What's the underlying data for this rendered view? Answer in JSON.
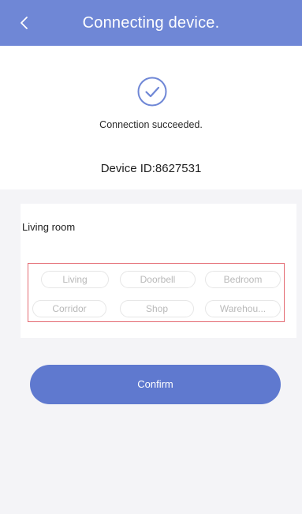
{
  "header": {
    "title": "Connecting device."
  },
  "status": {
    "message": "Connection succeeded.",
    "device_id": "Device ID:8627531"
  },
  "name_field": {
    "value": "Living room"
  },
  "tags": [
    {
      "label": "Living"
    },
    {
      "label": "Doorbell"
    },
    {
      "label": "Bedroom"
    },
    {
      "label": "Corridor"
    },
    {
      "label": "Shop"
    },
    {
      "label": "Warehou..."
    }
  ],
  "actions": {
    "confirm_label": "Confirm"
  },
  "colors": {
    "header": "#6f87d6",
    "primary_button": "#5f79cf",
    "tag_box_border": "#e46a72",
    "check_icon": "#6f87d6"
  },
  "icons": {
    "back": "chevron-left-icon",
    "status": "check-circle-icon"
  }
}
